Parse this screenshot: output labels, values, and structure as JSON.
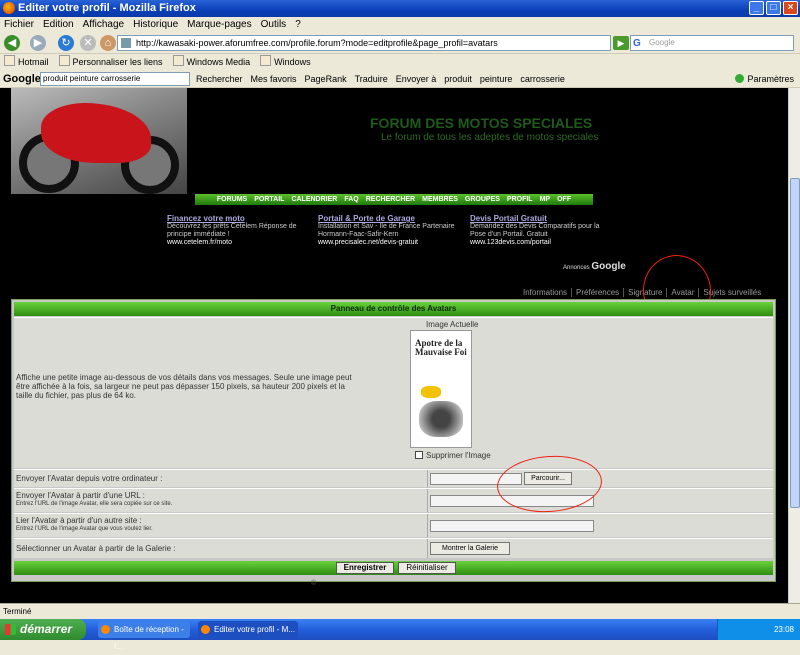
{
  "window": {
    "title": "Editer votre profil - Mozilla Firefox",
    "buttons": [
      "_",
      "□",
      "×"
    ]
  },
  "menu": [
    "Fichier",
    "Edition",
    "Affichage",
    "Historique",
    "Marque-pages",
    "Outils",
    "?"
  ],
  "address": {
    "url": "http://kawasaki-power.aforumfree.com/profile.forum?mode=editprofile&page_profil=avatars",
    "search_placeholder": "Google",
    "search_prefix": "G"
  },
  "bookmarks": [
    "Hotmail",
    "Personnaliser les liens",
    "Windows Media",
    "Windows"
  ],
  "google_toolbar": {
    "logo": "Google",
    "query": "produit peinture carrosserie",
    "items": [
      "Rechercher",
      "Mes favoris",
      "PageRank",
      "Traduire",
      "Envoyer à",
      "produit",
      "peinture",
      "carrosserie"
    ],
    "settings": "Paramètres"
  },
  "forum": {
    "title": "FORUM DES MOTOS SPECIALES",
    "subtitle": "Le forum de tous les adeptes de motos speciales",
    "nav": [
      "FORUMS",
      "PORTAIL",
      "CALENDRIER",
      "FAQ",
      "RECHERCHER",
      "MEMBRES",
      "GROUPES",
      "PROFIL",
      "MP",
      "OFF"
    ],
    "ads": [
      {
        "title": "Financez votre moto",
        "text": "Découvrez les prêts Cetelem Réponse de principe immédiate !",
        "url": "www.cetelem.fr/moto"
      },
      {
        "title": "Portail & Porte de Garage",
        "text": "Installation et Sav - Ile de France Partenaire Hormann-Faac-Safir-Kern",
        "url": "www.precisalec.net/devis-gratuit"
      },
      {
        "title": "Devis Portail Gratuit",
        "text": "Demandez des Devis Comparatifs pour la Pose d'un Portail. Gratuit",
        "url": "www.123devis.com/portail"
      }
    ],
    "ads_by": "Annonces",
    "ads_brand": "Google",
    "profile_tabs": [
      "Informations",
      "Préférences",
      "Signature",
      "Avatar",
      "Sujets surveillés"
    ]
  },
  "panel": {
    "header": "Panneau de contrôle des Avatars",
    "current_label": "Image Actuelle",
    "description": "Affiche une petite image au-dessous de vos détails dans vos messages. Seule une image peut être affichée à la fois, sa largeur ne peut pas dépasser 150 pixels, sa hauteur 200 pixels et la taille du fichier, pas plus de 64 ko.",
    "avatar_text": "Apotre de la Mauvaise Foi",
    "delete_label": "Supprimer l'Image",
    "upload_label": "Envoyer l'Avatar depuis votre ordinateur :",
    "browse": "Parcourir...",
    "url_label": "Envoyer l'Avatar à partir d'une URL :",
    "url_hint": "Entrez l'URL de l'image Avatar, elle sera copiée sur ce site.",
    "link_label": "Lier l'Avatar à partir d'un autre site :",
    "link_hint": "Entrez l'URL de l'image Avatar que vous voulez lier.",
    "gallery_label": "Sélectionner un Avatar à partir de la Galerie :",
    "gallery_button": "Montrer la Galerie",
    "save": "Enregistrer",
    "reset": "Réinitialiser",
    "copyright": "©"
  },
  "status": "Terminé",
  "taskbar": {
    "start": "démarrer",
    "tasks": [
      "Boîte de réception - I...",
      "Editer votre profil - M..."
    ],
    "lang": "FR",
    "time": "23:08"
  }
}
